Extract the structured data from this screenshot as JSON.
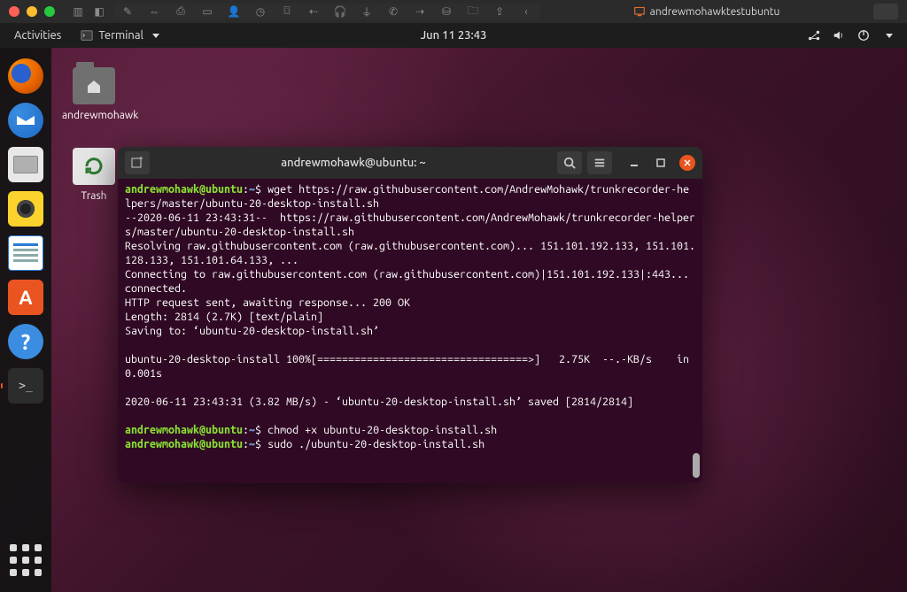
{
  "host": {
    "title": "andrewmohawktestubuntu"
  },
  "gnome": {
    "activities": "Activities",
    "app_menu": "Terminal",
    "clock": "Jun 11  23:43"
  },
  "desktop_icons": {
    "home_label": "andrewmohawk",
    "trash_label": "Trash"
  },
  "terminal": {
    "title": "andrewmohawk@ubuntu: ~",
    "prompt_user": "andrewmohawk@ubuntu",
    "prompt_path": "~",
    "prompt_symbol": "$",
    "cmd1": "wget https://raw.githubusercontent.com/AndrewMohawk/trunkrecorder-helpers/master/ubuntu-20-desktop-install.sh",
    "out1": "--2020-06-11 23:43:31--  https://raw.githubusercontent.com/AndrewMohawk/trunkrecorder-helpers/master/ubuntu-20-desktop-install.sh",
    "out2": "Resolving raw.githubusercontent.com (raw.githubusercontent.com)... 151.101.192.133, 151.101.128.133, 151.101.64.133, ...",
    "out3": "Connecting to raw.githubusercontent.com (raw.githubusercontent.com)|151.101.192.133|:443... connected.",
    "out4": "HTTP request sent, awaiting response... 200 OK",
    "out5": "Length: 2814 (2.7K) [text/plain]",
    "out6": "Saving to: ‘ubuntu-20-desktop-install.sh’",
    "out7": "ubuntu-20-desktop-install 100%[==================================>]   2.75K  --.-KB/s    in 0.001s",
    "out8": "2020-06-11 23:43:31 (3.82 MB/s) - ‘ubuntu-20-desktop-install.sh’ saved [2814/2814]",
    "cmd2": "chmod +x ubuntu-20-desktop-install.sh",
    "cmd3": "sudo ./ubuntu-20-desktop-install.sh"
  }
}
